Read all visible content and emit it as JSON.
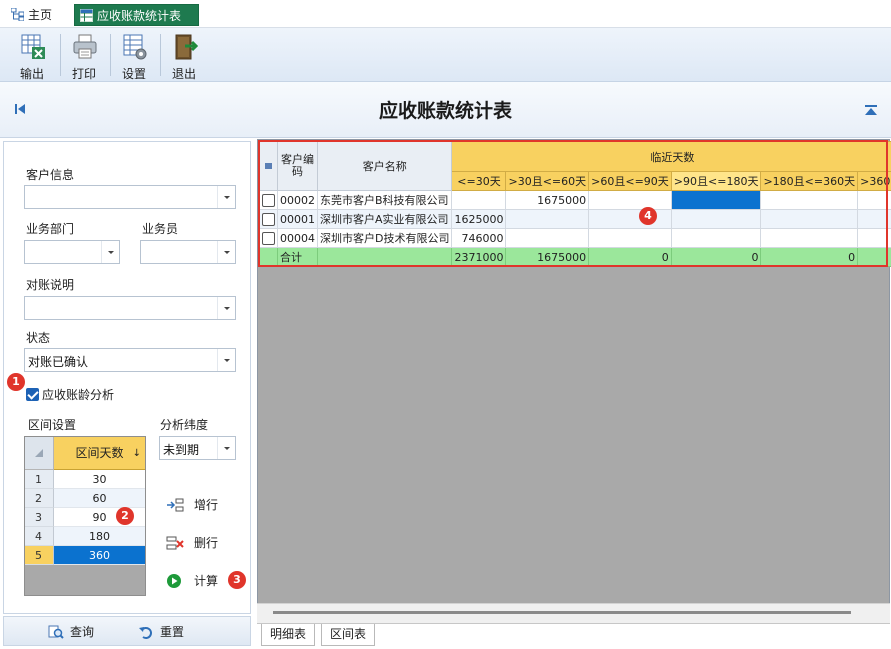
{
  "tabs": {
    "home": "主页",
    "active": "应收账款统计表"
  },
  "toolbar": {
    "export": "输出",
    "print": "打印",
    "settings": "设置",
    "exit": "退出"
  },
  "title": "应收账款统计表",
  "filters": {
    "customer_info_label": "客户信息",
    "customer_info_value": "",
    "dept_label": "业务部门",
    "dept_value": "",
    "salesman_label": "业务员",
    "salesman_value": "",
    "recon_label": "对账说明",
    "recon_value": "",
    "status_label": "状态",
    "status_value": "对账已确认",
    "aging_checkbox_label": "应收账龄分析",
    "aging_checked": true,
    "interval_label": "区间设置",
    "dimension_label": "分析纬度",
    "dimension_value": "未到期"
  },
  "interval_grid": {
    "header": "区间天数",
    "sort_glyph": "↓",
    "rows": [
      {
        "n": "1",
        "v": "30"
      },
      {
        "n": "2",
        "v": "60"
      },
      {
        "n": "3",
        "v": "90"
      },
      {
        "n": "4",
        "v": "180"
      },
      {
        "n": "5",
        "v": "360"
      }
    ]
  },
  "actions": {
    "add_row": "增行",
    "delete_row": "删行",
    "calculate": "计算"
  },
  "bottom": {
    "query": "查询",
    "reset": "重置"
  },
  "badges": {
    "b1": "1",
    "b2": "2",
    "b3": "3",
    "b4": "4"
  },
  "grid": {
    "group_header": "临近天数",
    "col_code": "客户编码",
    "col_code_l1": "客户编",
    "col_code_l2": "码",
    "col_name": "客户名称",
    "aging_cols": [
      "<=30天",
      ">30且<=60天",
      ">60且<=90天",
      ">90且<=180天",
      ">180且<=360天",
      ">360"
    ],
    "rows": [
      {
        "code": "00002",
        "name": "东莞市客户B科技有限公司",
        "v": [
          "",
          "1675000",
          "",
          "",
          "",
          ""
        ]
      },
      {
        "code": "00001",
        "name": "深圳市客户A实业有限公司",
        "v": [
          "1625000",
          "",
          "",
          "",
          "",
          ""
        ]
      },
      {
        "code": "00004",
        "name": "深圳市客户D技术有限公司",
        "v": [
          "746000",
          "",
          "",
          "",
          "",
          ""
        ]
      }
    ],
    "total": {
      "label": "合计",
      "v": [
        "2371000",
        "1675000",
        "0",
        "0",
        "0",
        ""
      ]
    }
  },
  "bottom_tabs": {
    "detail": "明细表",
    "interval": "区间表"
  },
  "colors": {
    "accent_tab": "#1e7a4f",
    "header_yellow": "#f8d160",
    "total_green": "#9be79b",
    "selected_blue": "#0b72cf",
    "badge_red": "#e0352b"
  }
}
